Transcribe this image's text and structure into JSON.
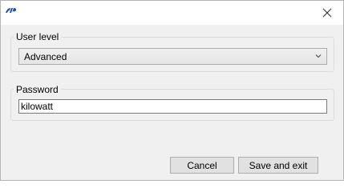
{
  "window": {
    "app_icon": "app-logo-icon",
    "close_icon": "close-icon"
  },
  "user_level": {
    "label": "User level",
    "selected": "Advanced"
  },
  "password": {
    "label": "Password",
    "value": "kilowatt"
  },
  "buttons": {
    "cancel": "Cancel",
    "save_exit": "Save and exit"
  },
  "colors": {
    "window_bg": "#f0f0f0",
    "titlebar_bg": "#ffffff",
    "app_icon_blue": "#1f4fb5"
  }
}
